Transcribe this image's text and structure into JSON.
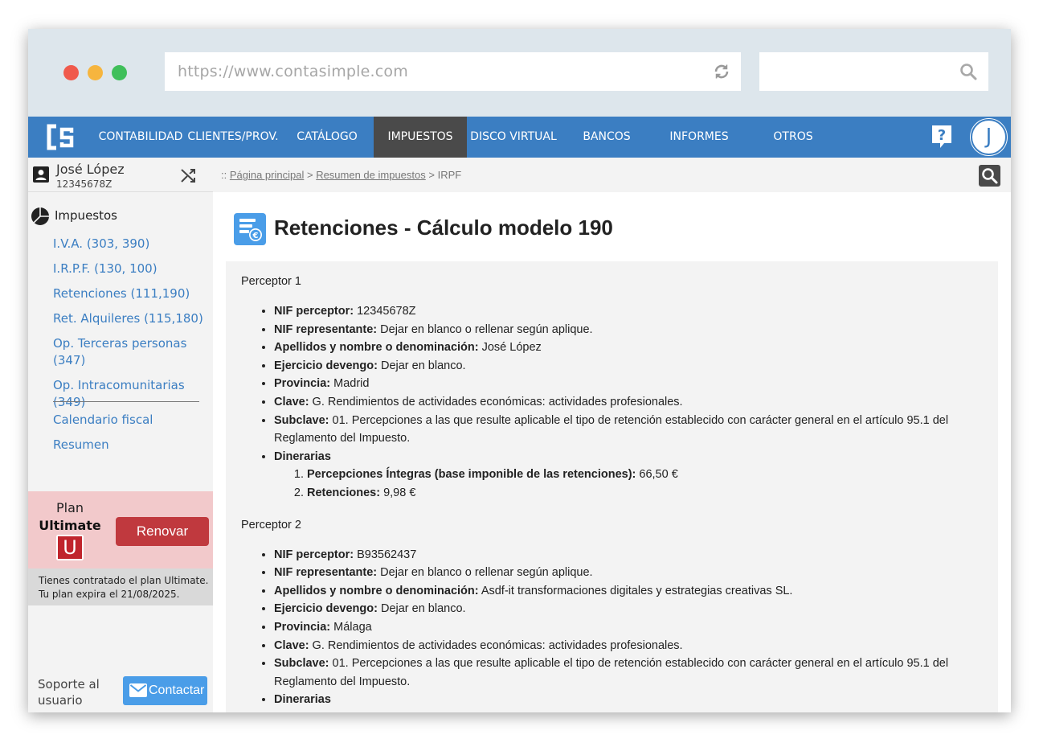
{
  "browser": {
    "url": "https://www.contasimple.com",
    "search_placeholder": ""
  },
  "nav": {
    "logo_text": "Cs",
    "items": [
      {
        "label": "CONTABILIDAD"
      },
      {
        "label": "CLIENTES/PROV."
      },
      {
        "label": "CATÁLOGO"
      },
      {
        "label": "IMPUESTOS"
      },
      {
        "label": "DISCO VIRTUAL"
      },
      {
        "label": "BANCOS"
      },
      {
        "label": "INFORMES"
      },
      {
        "label": "OTROS"
      }
    ],
    "active": "IMPUESTOS",
    "avatar_initial": "J"
  },
  "user": {
    "name": "José López",
    "id": "12345678Z"
  },
  "sidebar": {
    "section_title": "Impuestos",
    "links": [
      {
        "label": "I.V.A. (303, 390)"
      },
      {
        "label": "I.R.P.F. (130, 100)"
      },
      {
        "label": "Retenciones (111,190)"
      },
      {
        "label": "Ret. Alquileres (115,180)"
      },
      {
        "label": "Op. Terceras personas (347)"
      },
      {
        "label": "Op. Intracomunitarias (349)"
      },
      {
        "label": "Calendario fiscal"
      },
      {
        "label": "Resumen"
      }
    ],
    "plan_label": "Plan",
    "plan_name": "Ultimate",
    "plan_badge": "U",
    "renew_label": "Renovar",
    "plan_info_line1": "Tienes contratado el plan Ultimate.",
    "plan_info_line2": "Tu plan expira el 21/08/2025.",
    "support_line1": "Soporte al",
    "support_line2": "usuario",
    "contact_label": "Contactar"
  },
  "breadcrumb": {
    "prefix": ":: ",
    "home": "Página principal",
    "sep": " > ",
    "summary": "Resumen de impuestos",
    "current": "IRPF"
  },
  "page": {
    "title": "Retenciones - Cálculo modelo 190"
  },
  "perceptores": [
    {
      "title": "Perceptor 1",
      "nif_label": "NIF perceptor:",
      "nif": " 12345678Z",
      "rep_label": "NIF representante:",
      "rep": " Dejar en blanco o rellenar según aplique.",
      "name_label": "Apellidos y nombre o denominación:",
      "name": " José López",
      "ejercicio_label": "Ejercicio devengo:",
      "ejercicio": " Dejar en blanco.",
      "provincia_label": "Provincia:",
      "provincia": " Madrid",
      "clave_label": "Clave:",
      "clave": " G. Rendimientos de actividades económicas: actividades profesionales.",
      "subclave_label": "Subclave:",
      "subclave": " 01. Percepciones a las que resulte aplicable el tipo de retención establecido con carácter general en el artículo 95.1 del Reglamento del Impuesto.",
      "dinerarias_label": "Dinerarias",
      "integras_label": "Percepciones Íntegras (base imponible de las retenciones):",
      "integras": " 66,50 €",
      "retenciones_label": "Retenciones:",
      "retenciones": " 9,98 €"
    },
    {
      "title": "Perceptor 2",
      "nif_label": "NIF perceptor:",
      "nif": " B93562437",
      "rep_label": "NIF representante:",
      "rep": " Dejar en blanco o rellenar según aplique.",
      "name_label": "Apellidos y nombre o denominación:",
      "name": " Asdf-it transformaciones digitales y estrategias creativas SL.",
      "ejercicio_label": "Ejercicio devengo:",
      "ejercicio": " Dejar en blanco.",
      "provincia_label": "Provincia:",
      "provincia": " Málaga",
      "clave_label": "Clave:",
      "clave": " G. Rendimientos de actividades económicas: actividades profesionales.",
      "subclave_label": "Subclave:",
      "subclave": " 01. Percepciones a las que resulte aplicable el tipo de retención establecido con carácter general en el artículo 95.1 del Reglamento del Impuesto.",
      "dinerarias_label": "Dinerarias"
    }
  ],
  "colors": {
    "nav_bg": "#3b7ec2",
    "nav_active": "#4a4a4a",
    "link": "#3b7ec2",
    "renew": "#c0393e",
    "plan_bg": "#f2c9cb",
    "contact": "#4a9de8"
  }
}
